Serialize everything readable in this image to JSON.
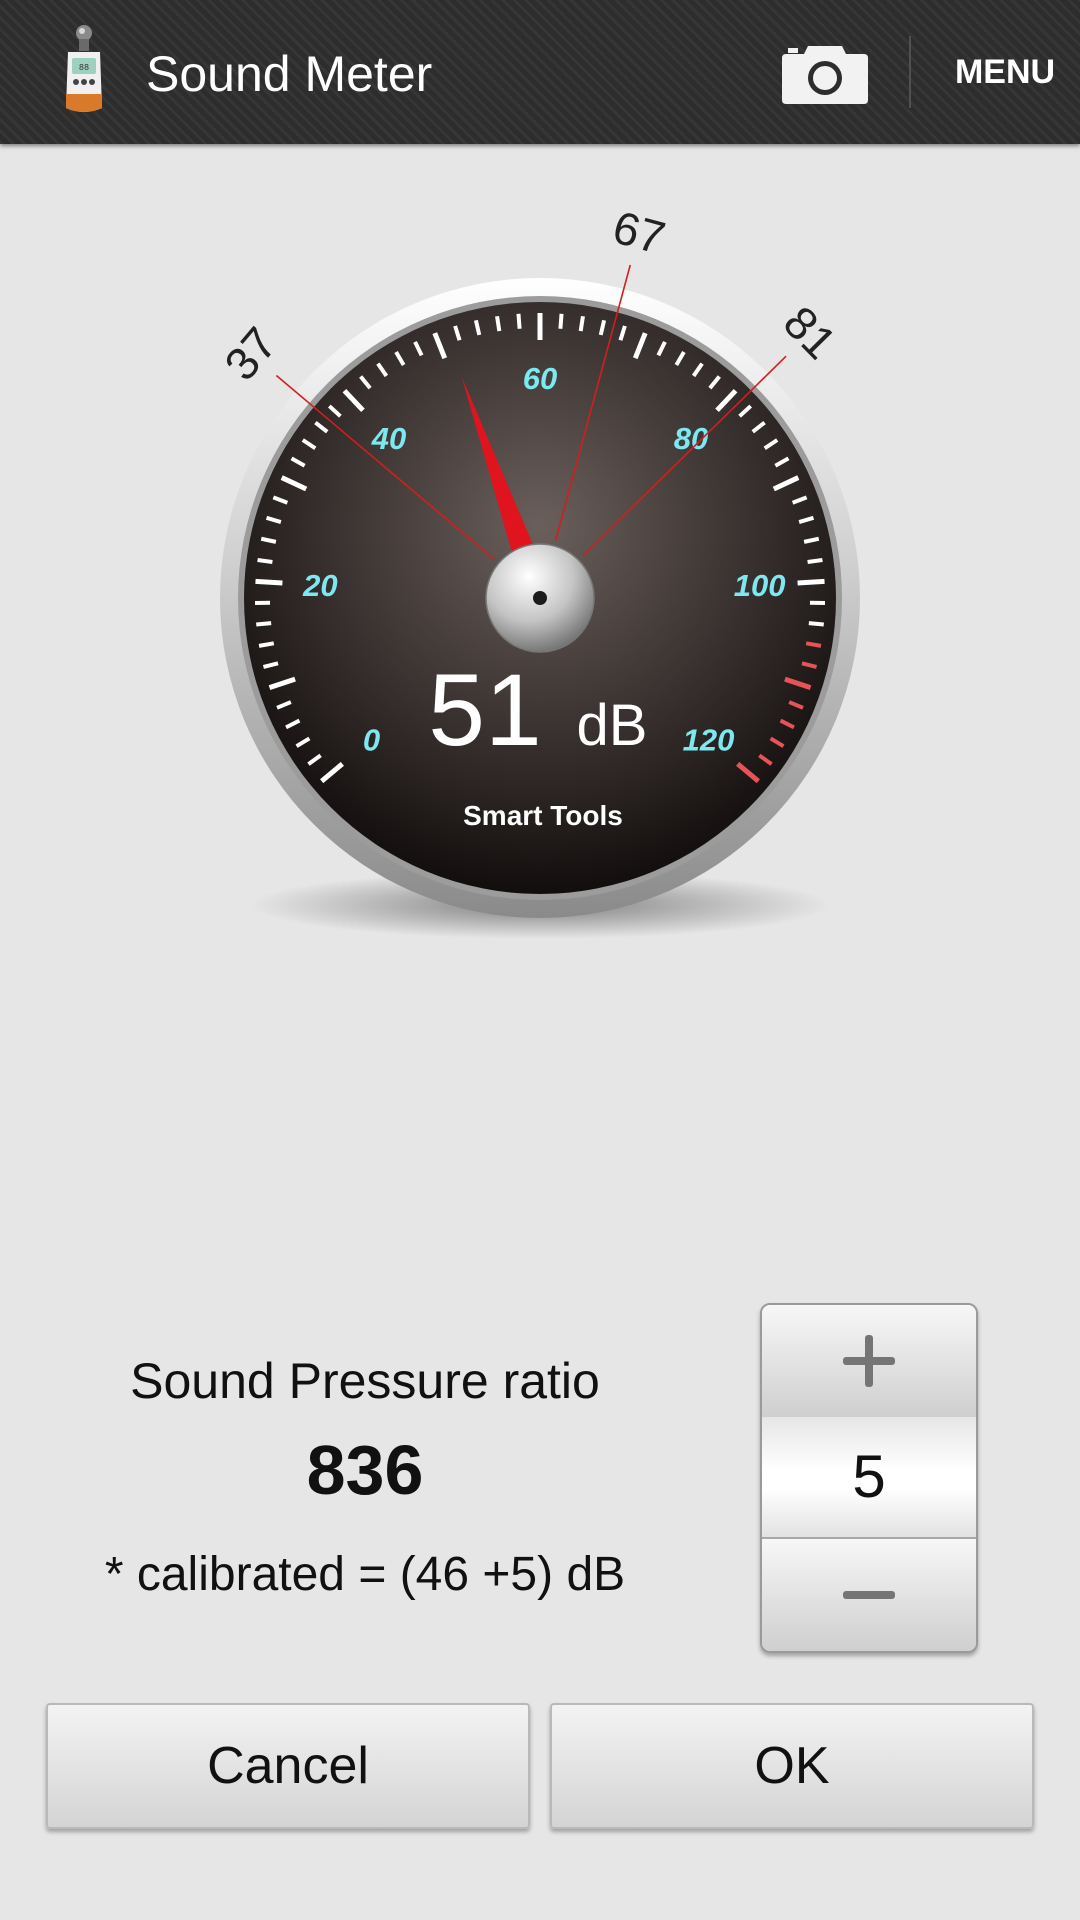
{
  "app_bar": {
    "title": "Sound Meter",
    "menu_label": "MENU",
    "icons": [
      "sound-meter-app-icon",
      "camera-icon"
    ]
  },
  "gauge": {
    "reading": "51",
    "unit": "dB",
    "brand": "Smart Tools",
    "scale_labels": [
      "0",
      "20",
      "40",
      "60",
      "80",
      "100",
      "120"
    ],
    "min_marker": "37",
    "avg_marker": "67",
    "max_marker": "81",
    "needle_value_db": 51,
    "scale_min": 0,
    "scale_max": 120,
    "colors": {
      "scale_label": "#7de8ef",
      "needle": "#e0141e",
      "marker_line": "#d21e1e",
      "danger_ticks": "#e8535a"
    }
  },
  "ratio_panel": {
    "label": "Sound Pressure ratio",
    "value": "836",
    "calibrated": "* calibrated = (46 +5) dB"
  },
  "stepper": {
    "value": "5",
    "plus_icon": "plus-icon",
    "minus_icon": "minus-icon"
  },
  "buttons": {
    "cancel": "Cancel",
    "ok": "OK"
  }
}
